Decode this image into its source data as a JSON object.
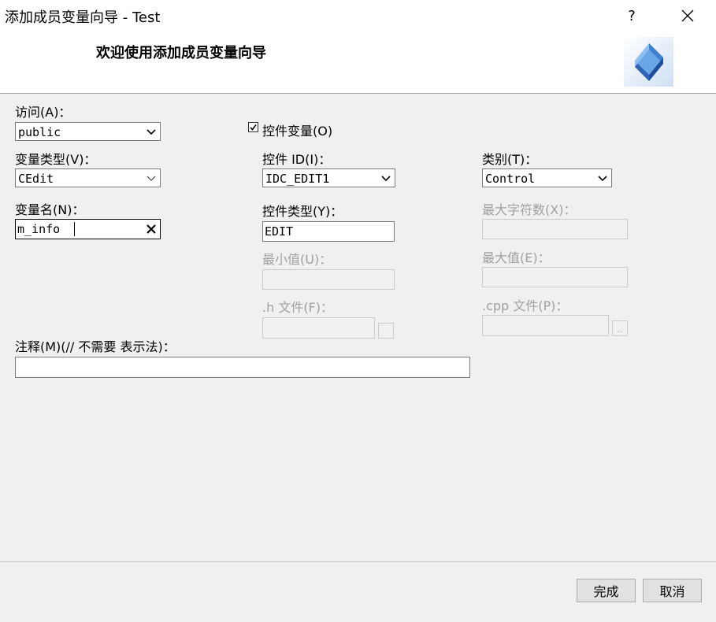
{
  "window": {
    "title": "添加成员变量向导 - Test",
    "help_label": "?",
    "close_label": "✕"
  },
  "header": {
    "title": "欢迎使用添加成员变量向导",
    "logo_icon": "cube-icon"
  },
  "form": {
    "access": {
      "label": "访问(A)：",
      "value": "public"
    },
    "control_var": {
      "label": "控件变量(O)",
      "checked": true,
      "check_glyph": "☑"
    },
    "var_type": {
      "label": "变量类型(V)：",
      "value": "CEdit"
    },
    "control_id": {
      "label": "控件 ID(I)：",
      "value": "IDC_EDIT1"
    },
    "category": {
      "label": "类别(T)：",
      "value": "Control"
    },
    "var_name": {
      "label": "变量名(N)：",
      "value": "m_info",
      "clear_glyph": "✕"
    },
    "control_type": {
      "label": "控件类型(Y)：",
      "value": "EDIT"
    },
    "max_chars": {
      "label": "最大字符数(X)：",
      "value": ""
    },
    "min_value": {
      "label": "最小值(U)：",
      "value": ""
    },
    "max_value": {
      "label": "最大值(E)：",
      "value": ""
    },
    "h_file": {
      "label": ".h 文件(F)：",
      "value": ""
    },
    "cpp_file": {
      "label": ".cpp 文件(P)：",
      "value": "",
      "browse_label": ".."
    },
    "comment": {
      "label": "注释(M)(// 不需要 表示法)：",
      "value": ""
    }
  },
  "buttons": {
    "finish": "完成",
    "cancel": "取消"
  },
  "colors": {
    "disabled_text": "#a0a0a0",
    "dialog_bg": "#f0f0f0"
  }
}
